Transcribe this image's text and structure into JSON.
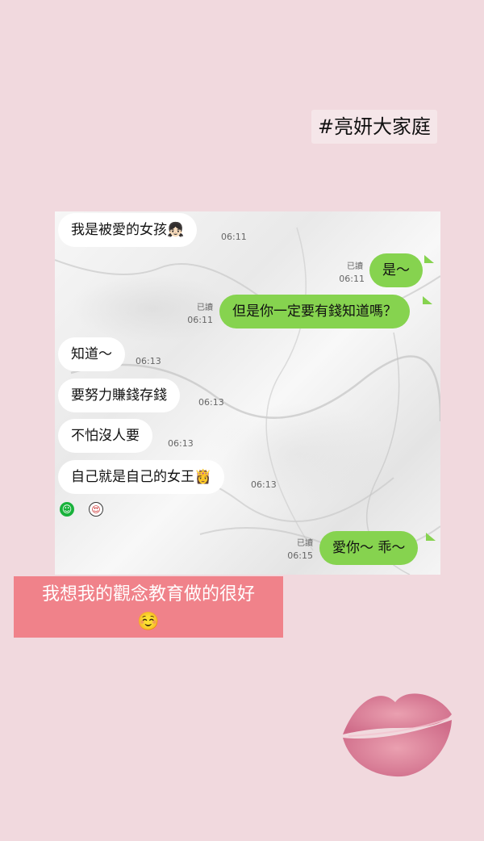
{
  "hashtag": "#亮妍大家庭",
  "messages": [
    {
      "side": "in",
      "text": "我是被愛的女孩",
      "emoji": "👧🏻",
      "time": "06:11",
      "read": ""
    },
    {
      "side": "out",
      "text": "是～",
      "emoji": "",
      "time": "06:11",
      "read": "已讀"
    },
    {
      "side": "out",
      "text": "但是你一定要有錢知道嗎？",
      "emoji": "",
      "time": "06:11",
      "read": "已讀"
    },
    {
      "side": "in",
      "text": "知道～",
      "emoji": "",
      "time": "06:13",
      "read": ""
    },
    {
      "side": "in",
      "text": "要努力賺錢存錢",
      "emoji": "",
      "time": "06:13",
      "read": ""
    },
    {
      "side": "in",
      "text": "不怕沒人要",
      "emoji": "",
      "time": "06:13",
      "read": ""
    },
    {
      "side": "in",
      "text": "自己就是自己的女王",
      "emoji": "👸",
      "time": "06:13",
      "read": ""
    },
    {
      "side": "out",
      "text": "愛你～ 乖～",
      "emoji": "",
      "time": "06:15",
      "read": "已讀"
    }
  ],
  "reactions": [
    {
      "icon": "smile-reaction-icon",
      "glyph": "☺"
    },
    {
      "icon": "heart-eyes-reaction-icon",
      "glyph": "😍"
    }
  ],
  "caption": {
    "line1": "我想我的觀念教育做的很好",
    "emoji": "☺️"
  },
  "colors": {
    "background": "#f1d9de",
    "out_bubble": "#86d34f",
    "caption_bg": "#f0828a",
    "lips": "#d9708a"
  }
}
